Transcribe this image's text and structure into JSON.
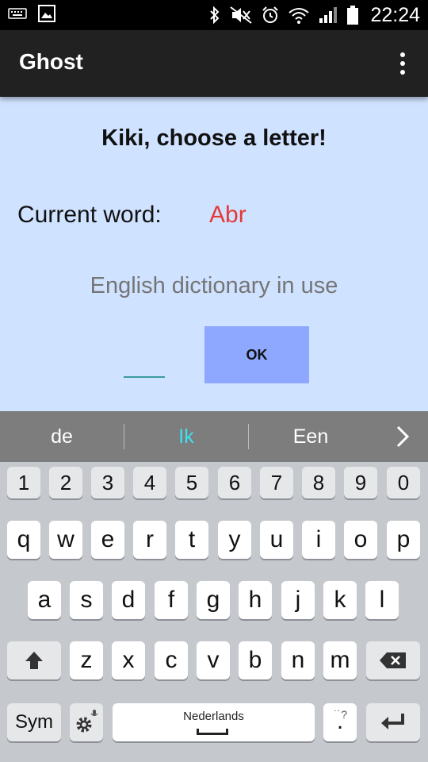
{
  "status_bar": {
    "time": "22:24",
    "icons": [
      "keyboard-icon",
      "image-icon",
      "bluetooth-icon",
      "mute-icon",
      "alarm-icon",
      "wifi-icon",
      "signal-icon",
      "battery-icon"
    ]
  },
  "app_bar": {
    "title": "Ghost",
    "menu_icon": "more-vert-icon"
  },
  "main": {
    "prompt": "Kiki, choose a letter!",
    "current_word_label": "Current word:",
    "current_word": "Abr",
    "dictionary_status": "English dictionary in use",
    "letter_input_value": "",
    "ok_label": "OK"
  },
  "suggestions": {
    "items": [
      "de",
      "Ik",
      "Een"
    ],
    "more_icon": "chevron-right-icon"
  },
  "keyboard": {
    "numbers": [
      "1",
      "2",
      "3",
      "4",
      "5",
      "6",
      "7",
      "8",
      "9",
      "0"
    ],
    "row1": [
      "q",
      "w",
      "e",
      "r",
      "t",
      "y",
      "u",
      "i",
      "o",
      "p"
    ],
    "row2": [
      "a",
      "s",
      "d",
      "f",
      "g",
      "h",
      "j",
      "k",
      "l"
    ],
    "row3": [
      "z",
      "x",
      "c",
      "v",
      "b",
      "n",
      "m"
    ],
    "shift_icon": "shift-arrow-icon",
    "backspace_icon": "backspace-icon",
    "sym_label": "Sym",
    "settings_icon": "gear-mic-icon",
    "space_label": "Nederlands",
    "period_label": ".",
    "period_alt": "˙˙?",
    "enter_icon": "enter-icon"
  },
  "colors": {
    "content_bg": "#cfe2ff",
    "app_bar": "#212121",
    "current_word": "#e53935",
    "ok_button": "#8fa8ff",
    "suggestion_highlight": "#40e0f0"
  }
}
